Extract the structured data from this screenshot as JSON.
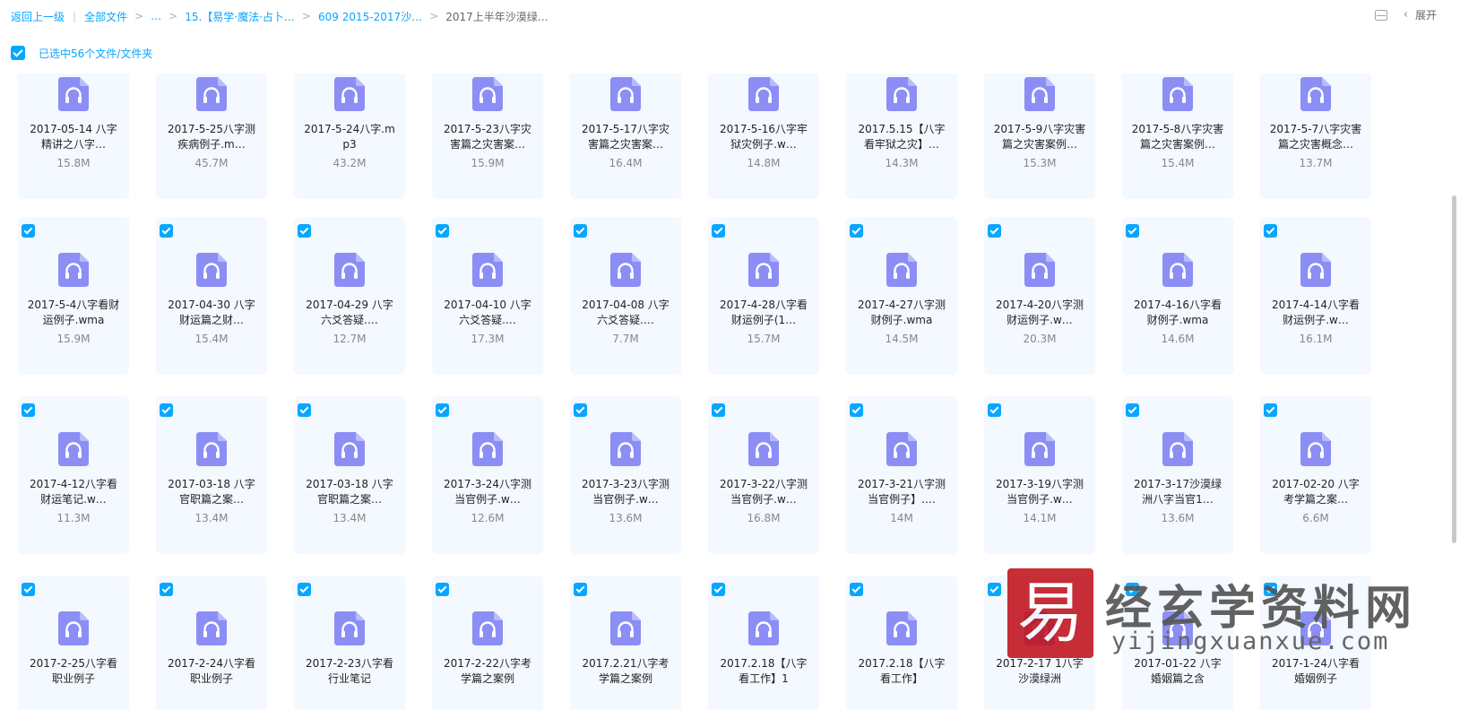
{
  "breadcrumb": {
    "back": "返回上一级",
    "all_files": "全部文件",
    "ellipsis": "…",
    "level1": "15.【易学·魔法·占卜…",
    "level2": "609 2015-2017沙…",
    "current": "2017上半年沙漠绿…"
  },
  "toolbar": {
    "expand_label": "展开"
  },
  "selection": {
    "label": "已选中56个文件/文件夹"
  },
  "rows": [
    {
      "checked": false,
      "files": [
        {
          "name": "2017-05-14 八字精讲之八字…",
          "size": "15.8M"
        },
        {
          "name": "2017-5-25八字测疾病例子.m…",
          "size": "45.7M"
        },
        {
          "name": "2017-5-24八字.mp3",
          "size": "43.2M"
        },
        {
          "name": "2017-5-23八字灾害篇之灾害案…",
          "size": "15.9M"
        },
        {
          "name": "2017-5-17八字灾害篇之灾害案…",
          "size": "16.4M"
        },
        {
          "name": "2017-5-16八字牢狱灾例子.w…",
          "size": "14.8M"
        },
        {
          "name": "2017.5.15【八字看牢狱之灾】…",
          "size": "14.3M"
        },
        {
          "name": "2017-5-9八字灾害篇之灾害案例…",
          "size": "15.3M"
        },
        {
          "name": "2017-5-8八字灾害篇之灾害案例…",
          "size": "15.4M"
        },
        {
          "name": "2017-5-7八字灾害篇之灾害概念…",
          "size": "13.7M"
        }
      ]
    },
    {
      "checked": true,
      "files": [
        {
          "name": "2017-5-4八字看财运例子.wma",
          "size": "15.9M"
        },
        {
          "name": "2017-04-30 八字财运篇之财…",
          "size": "15.4M"
        },
        {
          "name": "2017-04-29 八字六爻答疑.…",
          "size": "12.7M"
        },
        {
          "name": "2017-04-10 八字六爻答疑.…",
          "size": "17.3M"
        },
        {
          "name": "2017-04-08 八字六爻答疑.…",
          "size": "7.7M"
        },
        {
          "name": "2017-4-28八字看财运例子(1…",
          "size": "15.7M"
        },
        {
          "name": "2017-4-27八字测财例子.wma",
          "size": "14.5M"
        },
        {
          "name": "2017-4-20八字测财运例子.w…",
          "size": "20.3M"
        },
        {
          "name": "2017-4-16八字看财例子.wma",
          "size": "14.6M"
        },
        {
          "name": "2017-4-14八字看财运例子.w…",
          "size": "16.1M"
        }
      ]
    },
    {
      "checked": true,
      "files": [
        {
          "name": "2017-4-12八字看财运笔记.w…",
          "size": "11.3M"
        },
        {
          "name": "2017-03-18 八字官职篇之案…",
          "size": "13.4M"
        },
        {
          "name": "2017-03-18 八字官职篇之案…",
          "size": "13.4M"
        },
        {
          "name": "2017-3-24八字测当官例子.w…",
          "size": "12.6M"
        },
        {
          "name": "2017-3-23八字测当官例子.w…",
          "size": "13.6M"
        },
        {
          "name": "2017-3-22八字测当官例子.w…",
          "size": "16.8M"
        },
        {
          "name": "2017-3-21八字测当官例子】.…",
          "size": "14M"
        },
        {
          "name": "2017-3-19八字测当官例子.w…",
          "size": "14.1M"
        },
        {
          "name": "2017-3-17沙漠绿洲八字当官1…",
          "size": "13.6M"
        },
        {
          "name": "2017-02-20 八字考学篇之案…",
          "size": "6.6M"
        }
      ]
    },
    {
      "checked": true,
      "files": [
        {
          "name": "2017-2-25八字看职业例子",
          "size": ""
        },
        {
          "name": "2017-2-24八字看职业例子",
          "size": ""
        },
        {
          "name": "2017-2-23八字看行业笔记",
          "size": ""
        },
        {
          "name": "2017-2-22八字考学篇之案例",
          "size": ""
        },
        {
          "name": "2017.2.21八字考学篇之案例",
          "size": ""
        },
        {
          "name": "2017.2.18【八字看工作】1",
          "size": ""
        },
        {
          "name": "2017.2.18【八字看工作】",
          "size": ""
        },
        {
          "name": "2017-2-17 1八字沙漠绿洲",
          "size": ""
        },
        {
          "name": "2017-01-22 八字婚姻篇之含",
          "size": ""
        },
        {
          "name": "2017-1-24八字看婚姻例子",
          "size": ""
        }
      ]
    }
  ],
  "watermark": {
    "seal_glyph": "易",
    "title": "经玄学资料网",
    "url": "yijingxuanxue.com"
  },
  "icon_color": "#8b8ef5",
  "accent": "#06a7ff"
}
